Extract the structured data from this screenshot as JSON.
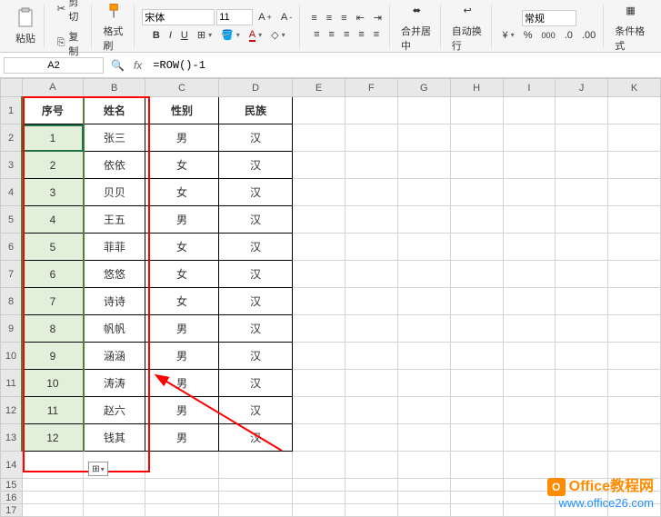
{
  "ribbon": {
    "paste": "粘贴",
    "cut": "剪切",
    "copy": "复制",
    "format_painter": "格式刷",
    "font_name": "宋体",
    "font_size": "11",
    "merge_center": "合并居中",
    "wrap_text": "自动换行",
    "number_format": "常规",
    "cond_format": "条件格式"
  },
  "formula_bar": {
    "name_box": "A2",
    "formula": "=ROW()-1"
  },
  "columns": [
    "A",
    "B",
    "C",
    "D",
    "E",
    "F",
    "G",
    "H",
    "I",
    "J",
    "K"
  ],
  "table": {
    "headers": {
      "a": "序号",
      "b": "姓名",
      "c": "性别",
      "d": "民族"
    },
    "rows": [
      {
        "n": "1",
        "name": "张三",
        "sex": "男",
        "nation": "汉"
      },
      {
        "n": "2",
        "name": "依依",
        "sex": "女",
        "nation": "汉"
      },
      {
        "n": "3",
        "name": "贝贝",
        "sex": "女",
        "nation": "汉"
      },
      {
        "n": "4",
        "name": "王五",
        "sex": "男",
        "nation": "汉"
      },
      {
        "n": "5",
        "name": "菲菲",
        "sex": "女",
        "nation": "汉"
      },
      {
        "n": "6",
        "name": "悠悠",
        "sex": "女",
        "nation": "汉"
      },
      {
        "n": "7",
        "name": "诗诗",
        "sex": "女",
        "nation": "汉"
      },
      {
        "n": "8",
        "name": "帆帆",
        "sex": "男",
        "nation": "汉"
      },
      {
        "n": "9",
        "name": "涵涵",
        "sex": "男",
        "nation": "汉"
      },
      {
        "n": "10",
        "name": "涛涛",
        "sex": "男",
        "nation": "汉"
      },
      {
        "n": "11",
        "name": "赵六",
        "sex": "男",
        "nation": "汉"
      },
      {
        "n": "12",
        "name": "钱其",
        "sex": "男",
        "nation": "汉"
      }
    ]
  },
  "watermark": {
    "title": "Office教程网",
    "url": "www.office26.com"
  }
}
